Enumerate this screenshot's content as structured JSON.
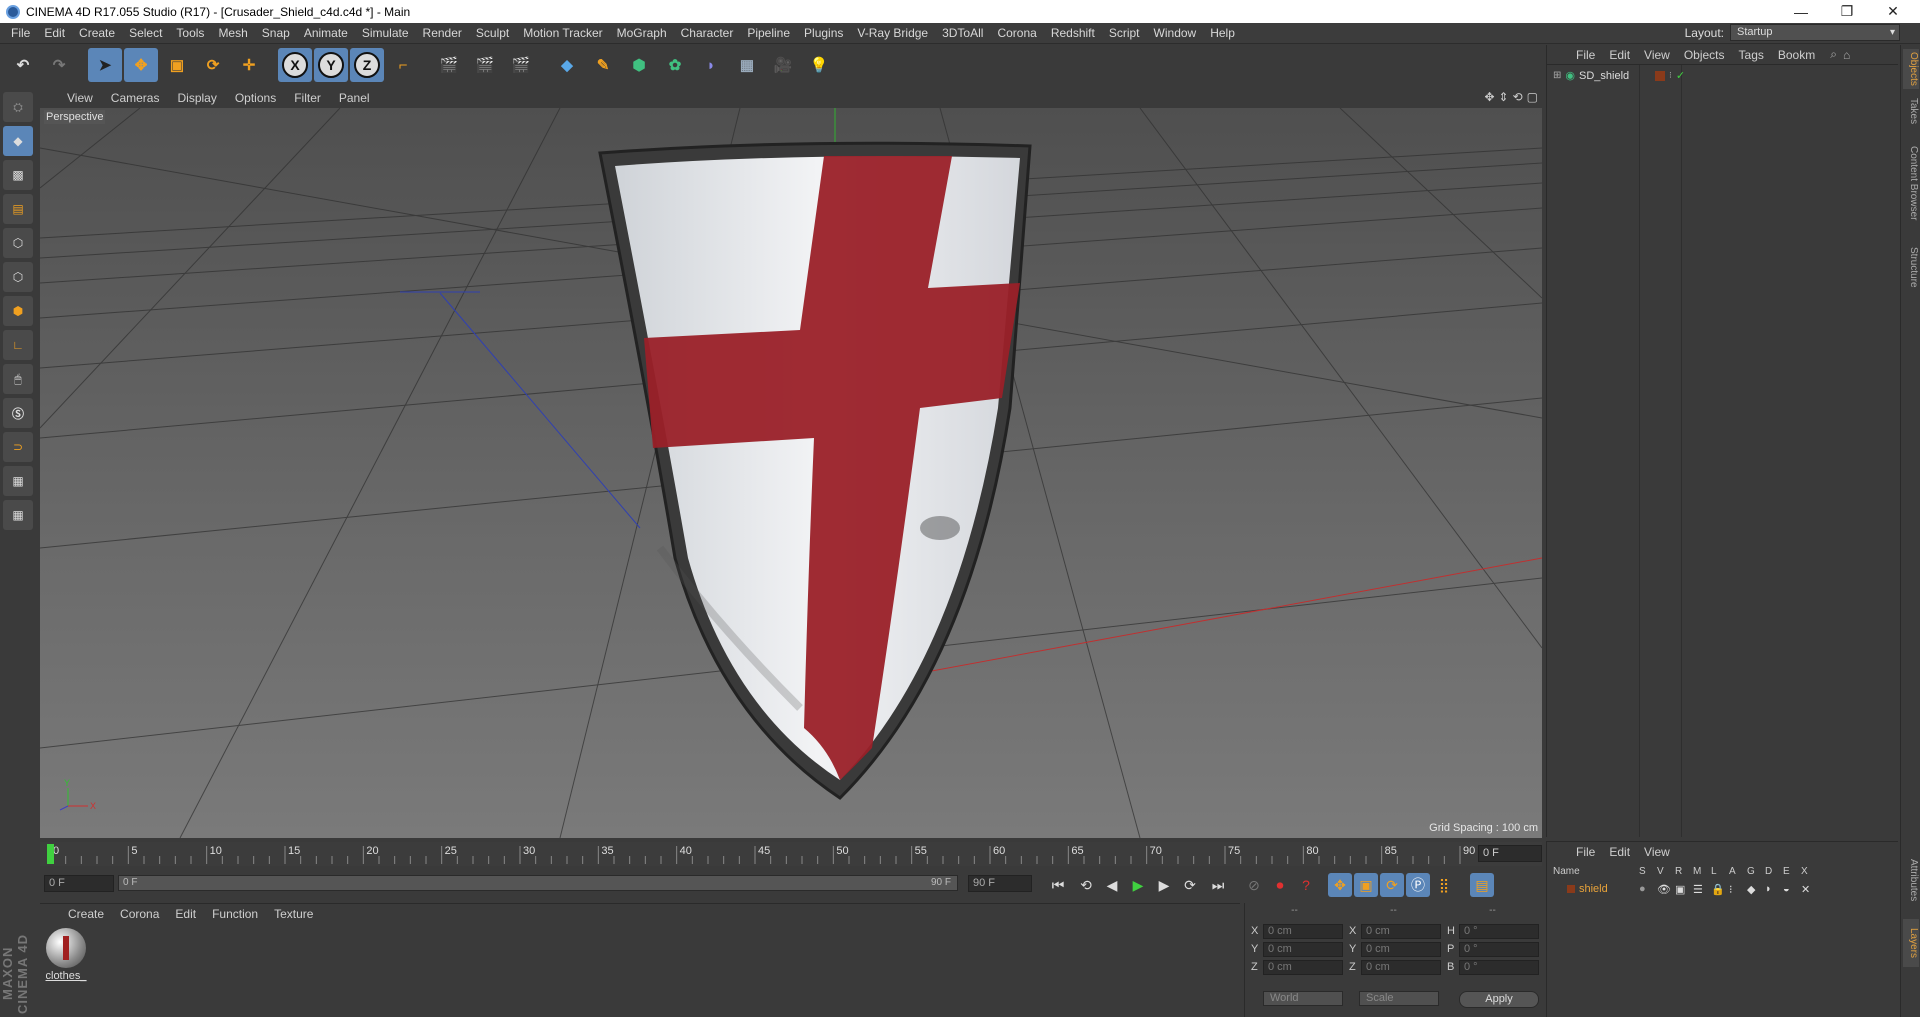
{
  "window": {
    "title": "CINEMA 4D R17.055 Studio (R17) - [Crusader_Shield_c4d.c4d *] - Main",
    "min": "—",
    "max": "❐",
    "close": "✕"
  },
  "menubar": [
    "File",
    "Edit",
    "Create",
    "Select",
    "Tools",
    "Mesh",
    "Snap",
    "Animate",
    "Simulate",
    "Render",
    "Sculpt",
    "Motion Tracker",
    "MoGraph",
    "Character",
    "Pipeline",
    "Plugins",
    "V-Ray Bridge",
    "3DToAll",
    "Corona",
    "Redshift",
    "Script",
    "Window",
    "Help"
  ],
  "layout": {
    "label": "Layout:",
    "value": "Startup"
  },
  "viewport": {
    "menu": [
      "View",
      "Cameras",
      "Display",
      "Options",
      "Filter",
      "Panel"
    ],
    "camera_label": "Perspective",
    "grid_spacing": "Grid Spacing : 100 cm",
    "axis_labels": {
      "x": "X",
      "y": "Y"
    }
  },
  "timeline": {
    "ticks": [
      "0",
      "5",
      "10",
      "15",
      "20",
      "25",
      "30",
      "35",
      "40",
      "45",
      "50",
      "55",
      "60",
      "65",
      "70",
      "75",
      "80",
      "85",
      "90"
    ],
    "current_frame": "0 F",
    "start_field": "0 F",
    "scrub_start": "0 F",
    "scrub_end": "90 F",
    "end_field": "90 F"
  },
  "material_manager": {
    "menu": [
      "Create",
      "Corona",
      "Edit",
      "Function",
      "Texture"
    ],
    "material_name": "clothes_"
  },
  "coordinates": {
    "headers": [
      "--",
      "--",
      "--"
    ],
    "rows": [
      {
        "k1": "X",
        "v1": "0 cm",
        "k2": "X",
        "v2": "0 cm",
        "k3": "H",
        "v3": "0 °"
      },
      {
        "k1": "Y",
        "v1": "0 cm",
        "k2": "Y",
        "v2": "0 cm",
        "k3": "P",
        "v3": "0 °"
      },
      {
        "k1": "Z",
        "v1": "0 cm",
        "k2": "Z",
        "v2": "0 cm",
        "k3": "B",
        "v3": "0 °"
      }
    ],
    "mode": "World",
    "size": "Scale",
    "apply": "Apply"
  },
  "objects_panel": {
    "menu": [
      "File",
      "Edit",
      "View",
      "Objects",
      "Tags",
      "Bookm"
    ],
    "object_name": "SD_shield"
  },
  "layers_panel": {
    "menu": [
      "File",
      "Edit",
      "View"
    ],
    "columns": [
      "Name",
      "S",
      "V",
      "R",
      "M",
      "L",
      "A",
      "G",
      "D",
      "E",
      "X"
    ],
    "layer_name": "shield",
    "layer_color": "#8a3a1a"
  },
  "right_tabs": [
    "Objects",
    "Takes",
    "Content Browser",
    "Structure",
    "Attributes",
    "Layers"
  ],
  "maxon_logo": "MAXON CINEMA 4D",
  "colors": {
    "accent": "#5b86b8",
    "cross_red": "#9a2028",
    "layer_name_orange": "#e8a33a"
  }
}
